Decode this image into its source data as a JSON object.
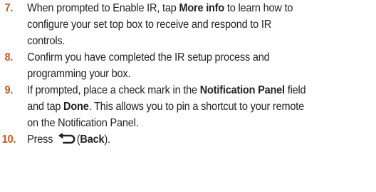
{
  "steps": [
    {
      "number": "7.",
      "lines": [
        [
          "When prompted to Enable IR, tap ",
          "More info",
          " to learn how to"
        ],
        [
          "configure your set top box to receive and respond to IR"
        ],
        [
          "controls."
        ]
      ]
    },
    {
      "number": "8.",
      "lines": [
        [
          "Confirm you have completed the IR setup process and"
        ],
        [
          "programming your box."
        ]
      ]
    },
    {
      "number": "9.",
      "lines": [
        [
          "If prompted, place a check mark in the ",
          "Notification Panel",
          " field"
        ],
        [
          "and tap ",
          "Done",
          ". This allows you to pin a shortcut to your remote"
        ],
        [
          "on the Notification Panel."
        ]
      ]
    },
    {
      "number": "10.",
      "press": "Press",
      "icon": "back-arrow-icon",
      "paren_open": "(",
      "back_label": "Back",
      "paren_close": ")."
    }
  ],
  "colors": {
    "number": "#c8561e",
    "text": "#222222"
  }
}
